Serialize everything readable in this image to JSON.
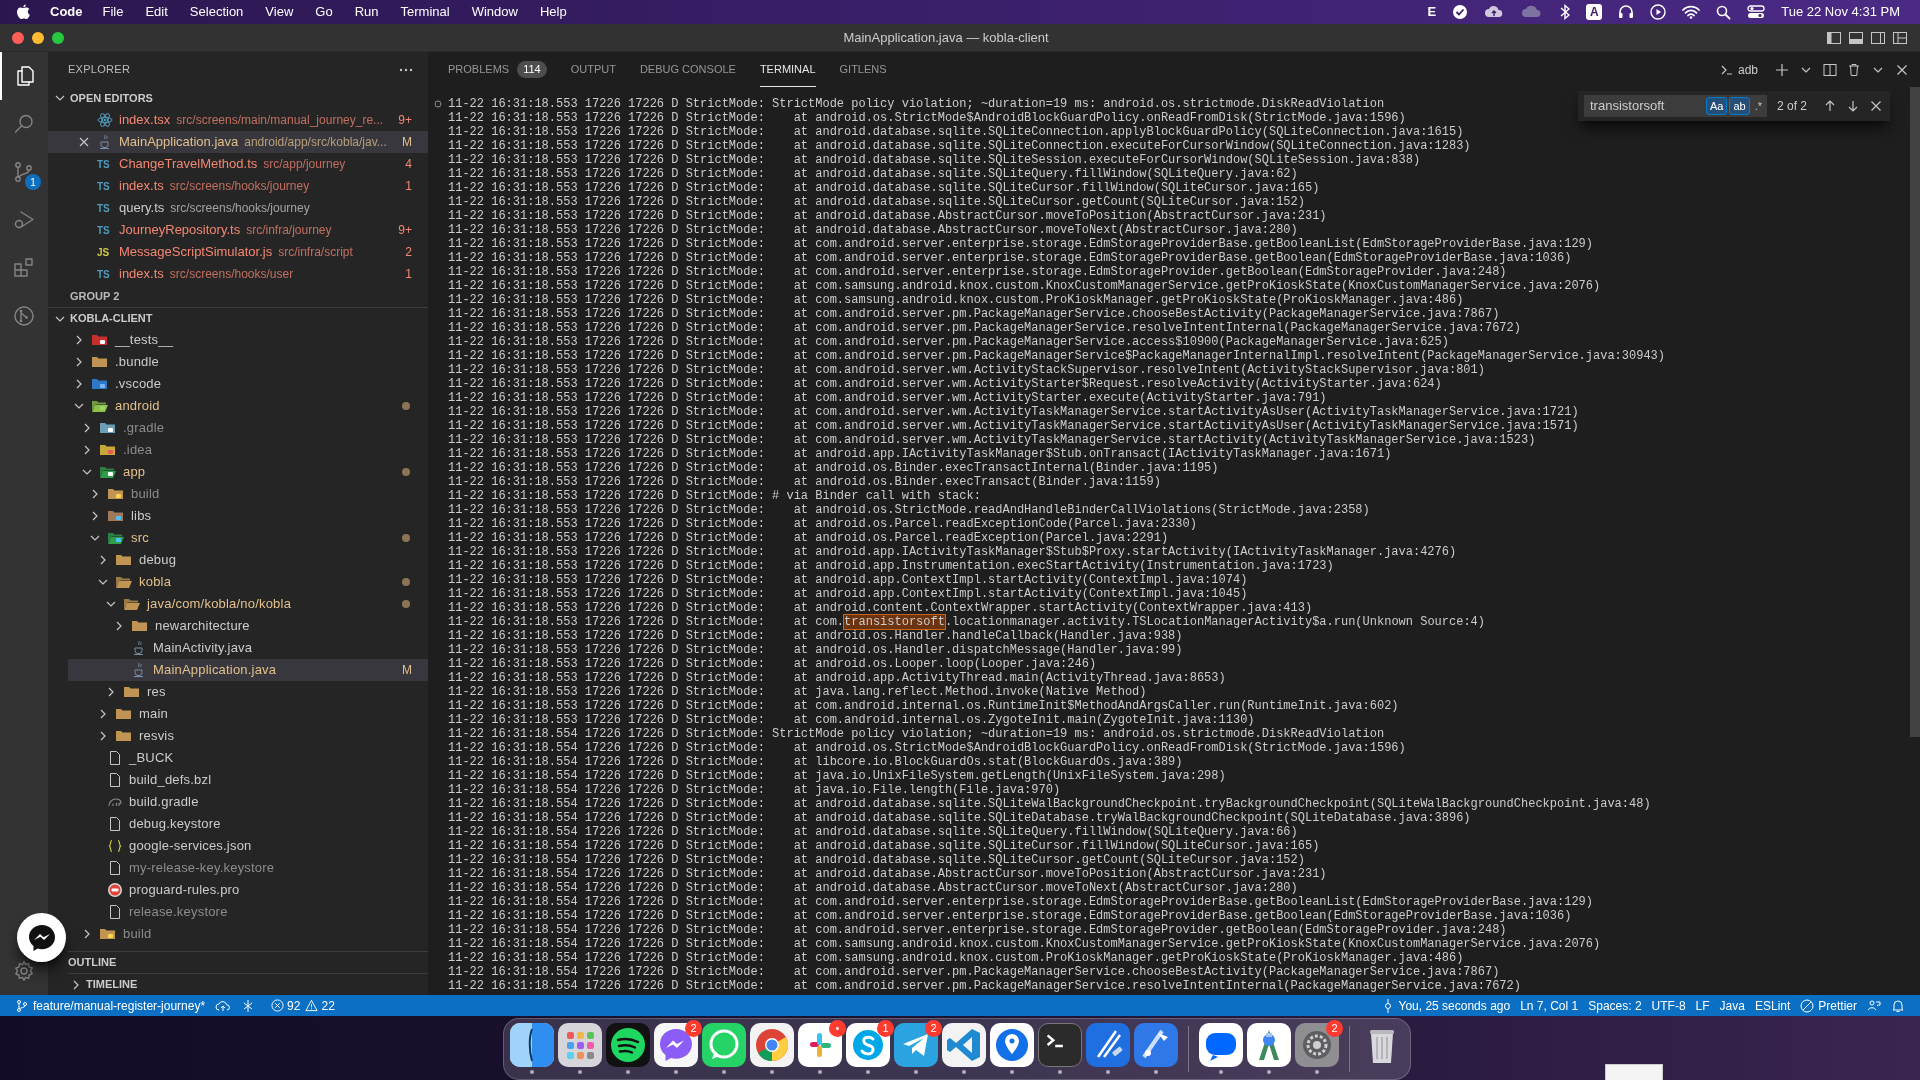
{
  "menu_bar": {
    "app_name": "Code",
    "menus": [
      "File",
      "Edit",
      "Selection",
      "View",
      "Go",
      "Run",
      "Terminal",
      "Window",
      "Help"
    ],
    "input_indicator": "E",
    "keyboard_indicator": "A",
    "clock": "Tue 22 Nov 4:31 PM"
  },
  "window": {
    "title": "MainApplication.java — kobla-client"
  },
  "activity_bar": {
    "source_control_badge": "1"
  },
  "sidebar": {
    "title": "EXPLORER",
    "open_editors": {
      "title": "OPEN EDITORS",
      "items": [
        {
          "kind": "react",
          "name": "index.tsx",
          "path": "src/screens/main/manual_journey_re...",
          "badge": "9+",
          "color": "#f48771",
          "selected": false
        },
        {
          "kind": "java",
          "name": "MainApplication.java",
          "path": "android/app/src/kobla/jav...",
          "badge": "M",
          "color": "#e2c08d",
          "selected": true
        },
        {
          "kind": "ts",
          "icon_label": "TS",
          "name": "ChangeTravelMethod.ts",
          "path": "src/app/journey",
          "badge": "4",
          "color": "#f48771",
          "selected": false
        },
        {
          "kind": "ts",
          "icon_label": "TS",
          "name": "index.ts",
          "path": "src/screens/hooks/journey",
          "badge": "1",
          "color": "#f48771",
          "selected": false
        },
        {
          "kind": "ts",
          "icon_label": "TS",
          "name": "query.ts",
          "path": "src/screens/hooks/journey",
          "color": "#cccccc",
          "selected": false
        },
        {
          "kind": "ts",
          "icon_label": "TS",
          "name": "JourneyRepository.ts",
          "path": "src/infra/journey",
          "badge": "9+",
          "color": "#f48771",
          "selected": false
        },
        {
          "kind": "js",
          "icon_label": "JS",
          "name": "MessageScriptSimulator.js",
          "path": "src/infra/script",
          "badge": "2",
          "color": "#f48771",
          "selected": false
        },
        {
          "kind": "ts",
          "icon_label": "TS",
          "name": "index.ts",
          "path": "src/screens/hooks/user",
          "badge": "1",
          "color": "#f48771",
          "selected": false
        }
      ]
    },
    "group_label": "GROUP 2",
    "project": {
      "title": "KOBLA-CLIENT",
      "tree": [
        {
          "name": "__tests__",
          "kind": "tests",
          "color": "#cccccc",
          "expanded": false,
          "modified": false,
          "selected": false
        },
        {
          "name": ".bundle",
          "kind": "folder",
          "color": "#cccccc",
          "expanded": false,
          "modified": false,
          "selected": false
        },
        {
          "name": ".vscode",
          "kind": "vscode",
          "color": "#cccccc",
          "expanded": false,
          "modified": false,
          "selected": false
        },
        {
          "name": "android",
          "kind": "android",
          "color": "#e2c08d",
          "expanded": true,
          "modified": true,
          "selected": false,
          "children": [
            {
              "name": ".gradle",
              "kind": "gradle",
              "color": "#8c8c8c",
              "expanded": false,
              "modified": false,
              "selected": false
            },
            {
              "name": ".idea",
              "kind": "idea",
              "color": "#8c8c8c",
              "expanded": false,
              "modified": false,
              "selected": false
            },
            {
              "name": "app",
              "kind": "app",
              "color": "#e2c08d",
              "expanded": true,
              "modified": true,
              "selected": false,
              "children": [
                {
                  "name": "build",
                  "kind": "build",
                  "color": "#8c8c8c",
                  "expanded": false,
                  "modified": false,
                  "selected": false
                },
                {
                  "name": "libs",
                  "kind": "libs",
                  "color": "#cccccc",
                  "expanded": false,
                  "modified": false,
                  "selected": false
                },
                {
                  "name": "src",
                  "kind": "src",
                  "color": "#e2c08d",
                  "expanded": true,
                  "modified": true,
                  "selected": false,
                  "children": [
                    {
                      "name": "debug",
                      "kind": "folder",
                      "color": "#cccccc",
                      "expanded": false,
                      "modified": false,
                      "selected": false
                    },
                    {
                      "name": "kobla",
                      "kind": "folder",
                      "color": "#e2c08d",
                      "expanded": true,
                      "modified": true,
                      "selected": false,
                      "children": [
                        {
                          "name": "java/com/kobla/no/kobla",
                          "kind": "folder",
                          "color": "#e2c08d",
                          "expanded": true,
                          "modified": true,
                          "selected": false,
                          "children": [
                            {
                              "name": "newarchitecture",
                              "kind": "folder",
                              "color": "#cccccc",
                              "expanded": false,
                              "modified": false,
                              "selected": false
                            },
                            {
                              "name": "MainActivity.java",
                              "kind": "java",
                              "color": "#cccccc",
                              "modified": false,
                              "selected": false
                            },
                            {
                              "name": "MainApplication.java",
                              "kind": "java",
                              "color": "#e2c08d",
                              "badge": "M",
                              "selected": true
                            }
                          ]
                        },
                        {
                          "name": "res",
                          "kind": "folder",
                          "color": "#cccccc",
                          "expanded": false,
                          "modified": false,
                          "selected": false
                        }
                      ]
                    },
                    {
                      "name": "main",
                      "kind": "folder",
                      "color": "#cccccc",
                      "expanded": false,
                      "modified": false,
                      "selected": false
                    },
                    {
                      "name": "resvis",
                      "kind": "folder",
                      "color": "#cccccc",
                      "expanded": false,
                      "modified": false,
                      "selected": false
                    }
                  ]
                },
                {
                  "name": "_BUCK",
                  "kind": "file",
                  "color": "#cccccc",
                  "modified": false,
                  "selected": false
                },
                {
                  "name": "build_defs.bzl",
                  "kind": "file",
                  "color": "#cccccc",
                  "modified": false,
                  "selected": false
                },
                {
                  "name": "build.gradle",
                  "kind": "script",
                  "color": "#cccccc",
                  "modified": false,
                  "selected": false
                },
                {
                  "name": "debug.keystore",
                  "kind": "file",
                  "color": "#cccccc",
                  "modified": false,
                  "selected": false
                },
                {
                  "name": "google-services.json",
                  "kind": "json",
                  "color": "#cccccc",
                  "modified": false,
                  "selected": false
                },
                {
                  "name": "my-release-key.keystore",
                  "kind": "file",
                  "color": "#8c8c8c",
                  "modified": false,
                  "selected": false
                },
                {
                  "name": "proguard-rules.pro",
                  "kind": "proguard",
                  "color": "#cccccc",
                  "modified": false,
                  "selected": false
                },
                {
                  "name": "release.keystore",
                  "kind": "file",
                  "color": "#8c8c8c",
                  "modified": false,
                  "selected": false
                }
              ]
            },
            {
              "name": "build",
              "kind": "build",
              "color": "#8c8c8c",
              "expanded": false,
              "modified": false,
              "selected": false
            }
          ]
        }
      ]
    },
    "sections": [
      {
        "title": "OUTLINE"
      },
      {
        "title": "TIMELINE",
        "expanded": false
      }
    ]
  },
  "panel": {
    "tabs": [
      {
        "label": "PROBLEMS",
        "badge": "114",
        "selected": false
      },
      {
        "label": "OUTPUT",
        "selected": false
      },
      {
        "label": "DEBUG CONSOLE",
        "selected": false
      },
      {
        "label": "TERMINAL",
        "selected": true
      },
      {
        "label": "GITLENS",
        "selected": false
      }
    ],
    "terminal_name": "adb",
    "find": {
      "query": "transistorsoft",
      "options": [
        {
          "label": "Aa",
          "on": true
        },
        {
          "label": "ab",
          "on": true
        },
        {
          "label": ".*",
          "on": false
        }
      ],
      "result": "2 of 2"
    },
    "lines": [
      "11-22 16:31:18.553 17226 17226 D StrictMode: StrictMode policy violation; ~duration=19 ms: android.os.strictmode.DiskReadViolation",
      "11-22 16:31:18.553 17226 17226 D StrictMode:    at android.os.StrictMode$AndroidBlockGuardPolicy.onReadFromDisk(StrictMode.java:1596)",
      "11-22 16:31:18.553 17226 17226 D StrictMode:    at android.database.sqlite.SQLiteConnection.applyBlockGuardPolicy(SQLiteConnection.java:1615)",
      "11-22 16:31:18.553 17226 17226 D StrictMode:    at android.database.sqlite.SQLiteConnection.executeForCursorWindow(SQLiteConnection.java:1283)",
      "11-22 16:31:18.553 17226 17226 D StrictMode:    at android.database.sqlite.SQLiteSession.executeForCursorWindow(SQLiteSession.java:838)",
      "11-22 16:31:18.553 17226 17226 D StrictMode:    at android.database.sqlite.SQLiteQuery.fillWindow(SQLiteQuery.java:62)",
      "11-22 16:31:18.553 17226 17226 D StrictMode:    at android.database.sqlite.SQLiteCursor.fillWindow(SQLiteCursor.java:165)",
      "11-22 16:31:18.553 17226 17226 D StrictMode:    at android.database.sqlite.SQLiteCursor.getCount(SQLiteCursor.java:152)",
      "11-22 16:31:18.553 17226 17226 D StrictMode:    at android.database.AbstractCursor.moveToPosition(AbstractCursor.java:231)",
      "11-22 16:31:18.553 17226 17226 D StrictMode:    at android.database.AbstractCursor.moveToNext(AbstractCursor.java:280)",
      "11-22 16:31:18.553 17226 17226 D StrictMode:    at com.android.server.enterprise.storage.EdmStorageProviderBase.getBooleanList(EdmStorageProviderBase.java:129)",
      "11-22 16:31:18.553 17226 17226 D StrictMode:    at com.android.server.enterprise.storage.EdmStorageProviderBase.getBoolean(EdmStorageProviderBase.java:1036)",
      "11-22 16:31:18.553 17226 17226 D StrictMode:    at com.android.server.enterprise.storage.EdmStorageProvider.getBoolean(EdmStorageProvider.java:248)",
      "11-22 16:31:18.553 17226 17226 D StrictMode:    at com.samsung.android.knox.custom.KnoxCustomManagerService.getProKioskState(KnoxCustomManagerService.java:2076)",
      "11-22 16:31:18.553 17226 17226 D StrictMode:    at com.samsung.android.knox.custom.ProKioskManager.getProKioskState(ProKioskManager.java:486)",
      "11-22 16:31:18.553 17226 17226 D StrictMode:    at com.android.server.pm.PackageManagerService.chooseBestActivity(PackageManagerService.java:7867)",
      "11-22 16:31:18.553 17226 17226 D StrictMode:    at com.android.server.pm.PackageManagerService.resolveIntentInternal(PackageManagerService.java:7672)",
      "11-22 16:31:18.553 17226 17226 D StrictMode:    at com.android.server.pm.PackageManagerService.access$10900(PackageManagerService.java:625)",
      "11-22 16:31:18.553 17226 17226 D StrictMode:    at com.android.server.pm.PackageManagerService$PackageManagerInternalImpl.resolveIntent(PackageManagerService.java:30943)",
      "11-22 16:31:18.553 17226 17226 D StrictMode:    at com.android.server.wm.ActivityStackSupervisor.resolveIntent(ActivityStackSupervisor.java:801)",
      "11-22 16:31:18.553 17226 17226 D StrictMode:    at com.android.server.wm.ActivityStarter$Request.resolveActivity(ActivityStarter.java:624)",
      "11-22 16:31:18.553 17226 17226 D StrictMode:    at com.android.server.wm.ActivityStarter.execute(ActivityStarter.java:791)",
      "11-22 16:31:18.553 17226 17226 D StrictMode:    at com.android.server.wm.ActivityTaskManagerService.startActivityAsUser(ActivityTaskManagerService.java:1721)",
      "11-22 16:31:18.553 17226 17226 D StrictMode:    at com.android.server.wm.ActivityTaskManagerService.startActivityAsUser(ActivityTaskManagerService.java:1571)",
      "11-22 16:31:18.553 17226 17226 D StrictMode:    at com.android.server.wm.ActivityTaskManagerService.startActivity(ActivityTaskManagerService.java:1523)",
      "11-22 16:31:18.553 17226 17226 D StrictMode:    at android.app.IActivityTaskManager$Stub.onTransact(IActivityTaskManager.java:1671)",
      "11-22 16:31:18.553 17226 17226 D StrictMode:    at android.os.Binder.execTransactInternal(Binder.java:1195)",
      "11-22 16:31:18.553 17226 17226 D StrictMode:    at android.os.Binder.execTransact(Binder.java:1159)",
      "11-22 16:31:18.553 17226 17226 D StrictMode: # via Binder call with stack:",
      "11-22 16:31:18.553 17226 17226 D StrictMode:    at android.os.StrictMode.readAndHandleBinderCallViolations(StrictMode.java:2358)",
      "11-22 16:31:18.553 17226 17226 D StrictMode:    at android.os.Parcel.readExceptionCode(Parcel.java:2330)",
      "11-22 16:31:18.553 17226 17226 D StrictMode:    at android.os.Parcel.readException(Parcel.java:2291)",
      "11-22 16:31:18.553 17226 17226 D StrictMode:    at android.app.IActivityTaskManager$Stub$Proxy.startActivity(IActivityTaskManager.java:4276)",
      "11-22 16:31:18.553 17226 17226 D StrictMode:    at android.app.Instrumentation.execStartActivity(Instrumentation.java:1723)",
      "11-22 16:31:18.553 17226 17226 D StrictMode:    at android.app.ContextImpl.startActivity(ContextImpl.java:1074)",
      "11-22 16:31:18.553 17226 17226 D StrictMode:    at android.app.ContextImpl.startActivity(ContextImpl.java:1045)",
      "11-22 16:31:18.553 17226 17226 D StrictMode:    at android.content.ContextWrapper.startActivity(ContextWrapper.java:413)",
      {
        "kind": "match",
        "before": "11-22 16:31:18.553 17226 17226 D StrictMode:    at com.",
        "match": "transistorsoft",
        "after": ".locationmanager.activity.TSLocationManagerActivity$a.run(Unknown Source:4)"
      },
      "11-22 16:31:18.553 17226 17226 D StrictMode:    at android.os.Handler.handleCallback(Handler.java:938)",
      "11-22 16:31:18.553 17226 17226 D StrictMode:    at android.os.Handler.dispatchMessage(Handler.java:99)",
      "11-22 16:31:18.553 17226 17226 D StrictMode:    at android.os.Looper.loop(Looper.java:246)",
      "11-22 16:31:18.553 17226 17226 D StrictMode:    at android.app.ActivityThread.main(ActivityThread.java:8653)",
      "11-22 16:31:18.553 17226 17226 D StrictMode:    at java.lang.reflect.Method.invoke(Native Method)",
      "11-22 16:31:18.553 17226 17226 D StrictMode:    at com.android.internal.os.RuntimeInit$MethodAndArgsCaller.run(RuntimeInit.java:602)",
      "11-22 16:31:18.553 17226 17226 D StrictMode:    at com.android.internal.os.ZygoteInit.main(ZygoteInit.java:1130)",
      "11-22 16:31:18.554 17226 17226 D StrictMode: StrictMode policy violation; ~duration=19 ms: android.os.strictmode.DiskReadViolation",
      "11-22 16:31:18.554 17226 17226 D StrictMode:    at android.os.StrictMode$AndroidBlockGuardPolicy.onReadFromDisk(StrictMode.java:1596)",
      "11-22 16:31:18.554 17226 17226 D StrictMode:    at libcore.io.BlockGuardOs.stat(BlockGuardOs.java:389)",
      "11-22 16:31:18.554 17226 17226 D StrictMode:    at java.io.UnixFileSystem.getLength(UnixFileSystem.java:298)",
      "11-22 16:31:18.554 17226 17226 D StrictMode:    at java.io.File.length(File.java:970)",
      "11-22 16:31:18.554 17226 17226 D StrictMode:    at android.database.sqlite.SQLiteWalBackgroundCheckpoint.tryBackgroundCheckpoint(SQLiteWalBackgroundCheckpoint.java:48)",
      "11-22 16:31:18.554 17226 17226 D StrictMode:    at android.database.sqlite.SQLiteDatabase.tryWalBackgroundCheckpoint(SQLiteDatabase.java:3896)",
      "11-22 16:31:18.554 17226 17226 D StrictMode:    at android.database.sqlite.SQLiteQuery.fillWindow(SQLiteQuery.java:66)",
      "11-22 16:31:18.554 17226 17226 D StrictMode:    at android.database.sqlite.SQLiteCursor.fillWindow(SQLiteCursor.java:165)",
      "11-22 16:31:18.554 17226 17226 D StrictMode:    at android.database.sqlite.SQLiteCursor.getCount(SQLiteCursor.java:152)",
      "11-22 16:31:18.554 17226 17226 D StrictMode:    at android.database.AbstractCursor.moveToPosition(AbstractCursor.java:231)",
      "11-22 16:31:18.554 17226 17226 D StrictMode:    at android.database.AbstractCursor.moveToNext(AbstractCursor.java:280)",
      "11-22 16:31:18.554 17226 17226 D StrictMode:    at com.android.server.enterprise.storage.EdmStorageProviderBase.getBooleanList(EdmStorageProviderBase.java:129)",
      "11-22 16:31:18.554 17226 17226 D StrictMode:    at com.android.server.enterprise.storage.EdmStorageProviderBase.getBoolean(EdmStorageProviderBase.java:1036)",
      "11-22 16:31:18.554 17226 17226 D StrictMode:    at com.android.server.enterprise.storage.EdmStorageProvider.getBoolean(EdmStorageProvider.java:248)",
      "11-22 16:31:18.554 17226 17226 D StrictMode:    at com.samsung.android.knox.custom.KnoxCustomManagerService.getProKioskState(KnoxCustomManagerService.java:2076)",
      "11-22 16:31:18.554 17226 17226 D StrictMode:    at com.samsung.android.knox.custom.ProKioskManager.getProKioskState(ProKioskManager.java:486)",
      "11-22 16:31:18.554 17226 17226 D StrictMode:    at com.android.server.pm.PackageManagerService.chooseBestActivity(PackageManagerService.java:7867)",
      "11-22 16:31:18.554 17226 17226 D StrictMode:    at com.android.server.pm.PackageManagerService.resolveIntentInternal(PackageManagerService.java:7672)"
    ]
  },
  "status_bar": {
    "branch": "feature/manual-register-journey*",
    "errors": "92",
    "warnings": "22",
    "blame": "You, 25 seconds ago",
    "items": [
      "Ln 7, Col 1",
      "Spaces: 2",
      "UTF-8",
      "LF",
      "Java",
      "ESLint"
    ],
    "formatter": "Prettier"
  },
  "dock": {
    "apps": [
      {
        "kind": "finder"
      },
      {
        "kind": "launchpad"
      },
      {
        "kind": "spotify"
      },
      {
        "kind": "messenger",
        "badge": "2"
      },
      {
        "kind": "whatsapp"
      },
      {
        "kind": "chrome"
      },
      {
        "kind": "slack",
        "badge": "•"
      },
      {
        "kind": "skype",
        "badge": "1"
      },
      {
        "kind": "telegram",
        "badge": "2"
      },
      {
        "kind": "vscode"
      },
      {
        "kind": "pin"
      },
      {
        "kind": "terminal"
      },
      {
        "kind": "xcode"
      },
      {
        "kind": "instruments"
      },
      {
        "kind": "separator"
      },
      {
        "kind": "zalo"
      },
      {
        "kind": "studio"
      },
      {
        "kind": "settings",
        "badge": "2"
      },
      {
        "kind": "separator"
      },
      {
        "kind": "trash"
      }
    ]
  }
}
